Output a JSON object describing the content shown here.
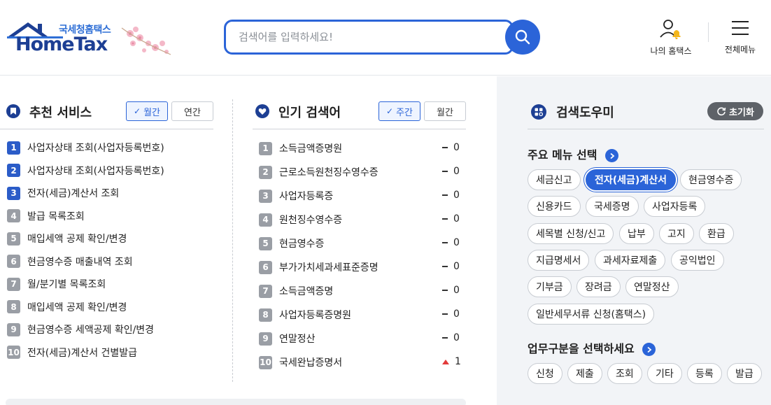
{
  "header": {
    "logo_sub": "국세청홈택스",
    "logo_main": "HomeTax",
    "search_placeholder": "검색어를 입력하세요!",
    "my_hometax_label": "나의 홈택스",
    "all_menu_label": "전체메뉴"
  },
  "recommended": {
    "title": "추천 서비스",
    "toggle_monthly": "월간",
    "toggle_yearly": "연간",
    "items": [
      {
        "rank": "1",
        "label": "사업자상태 조회(사업자등록번호)"
      },
      {
        "rank": "2",
        "label": "사업자상태 조회(사업자등록번호)"
      },
      {
        "rank": "3",
        "label": "전자(세금)계산서 조회"
      },
      {
        "rank": "4",
        "label": "발급 목록조회"
      },
      {
        "rank": "5",
        "label": "매입세액 공제 확인/변경"
      },
      {
        "rank": "6",
        "label": "현금영수증 매출내역 조회"
      },
      {
        "rank": "7",
        "label": "월/분기별 목록조회"
      },
      {
        "rank": "8",
        "label": "매입세액 공제 확인/변경"
      },
      {
        "rank": "9",
        "label": "현금영수증 세액공제 확인/변경"
      },
      {
        "rank": "10",
        "label": "전자(세금)계산서 건별발급"
      }
    ]
  },
  "popular": {
    "title": "인기 검색어",
    "toggle_weekly": "주간",
    "toggle_monthly": "월간",
    "items": [
      {
        "rank": "1",
        "label": "소득금액증명원",
        "change": "0",
        "dir": "same"
      },
      {
        "rank": "2",
        "label": "근로소득원천징수영수증",
        "change": "0",
        "dir": "same"
      },
      {
        "rank": "3",
        "label": "사업자등록증",
        "change": "0",
        "dir": "same"
      },
      {
        "rank": "4",
        "label": "원천징수영수증",
        "change": "0",
        "dir": "same"
      },
      {
        "rank": "5",
        "label": "현금영수증",
        "change": "0",
        "dir": "same"
      },
      {
        "rank": "6",
        "label": "부가가치세과세표준증명",
        "change": "0",
        "dir": "same"
      },
      {
        "rank": "7",
        "label": "소득금액증명",
        "change": "0",
        "dir": "same"
      },
      {
        "rank": "8",
        "label": "사업자등록증명원",
        "change": "0",
        "dir": "same"
      },
      {
        "rank": "9",
        "label": "연말정산",
        "change": "0",
        "dir": "same"
      },
      {
        "rank": "10",
        "label": "국세완납증명서",
        "change": "1",
        "dir": "up"
      }
    ]
  },
  "helper": {
    "title": "검색도우미",
    "reset_label": "초기화",
    "menu_select_title": "주요 메뉴 선택",
    "menu_chips": [
      "세금신고",
      "전자(세금)계산서",
      "현금영수증",
      "신용카드",
      "국세증명",
      "사업자등록",
      "세목별 신청/신고",
      "납부",
      "고지",
      "환급",
      "지급명세서",
      "과세자료제출",
      "공익법인",
      "기부금",
      "장려금",
      "연말정산",
      "일반세무서류 신청(홈택스)"
    ],
    "business_title": "업무구분을 선택하세요",
    "business_chips": [
      "신청",
      "제출",
      "조회",
      "기타",
      "등록",
      "발급"
    ]
  },
  "colors": {
    "accent": "#2b64d8",
    "rank_blue": "#2b5cc8",
    "rank_gray": "#9a9ea5",
    "up_red": "#e23b3b",
    "panel_bg": "#f2f4f7"
  }
}
